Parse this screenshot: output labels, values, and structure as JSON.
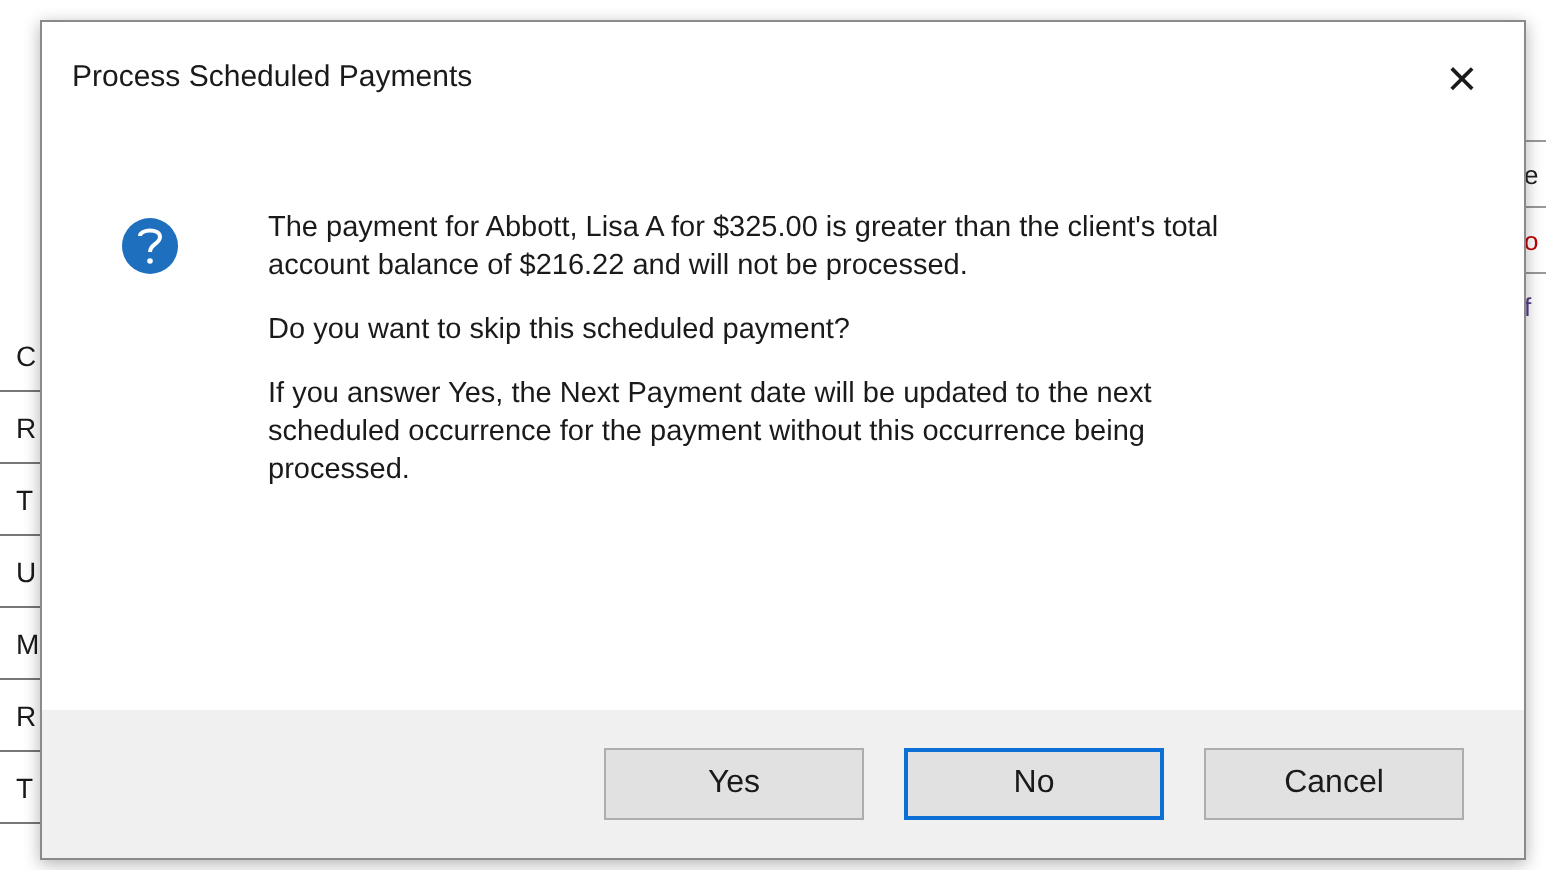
{
  "background": {
    "left_cells": [
      "C",
      "R",
      "T",
      "U",
      "M",
      "R",
      "T"
    ],
    "right_cells": [
      {
        "text": "e",
        "color": "#222222"
      },
      {
        "text": "o",
        "color": "#c00000"
      },
      {
        "text": "f",
        "color": "#5a3d8a"
      }
    ]
  },
  "dialog": {
    "title": "Process Scheduled Payments",
    "close": "×",
    "message": [
      "The payment for Abbott, Lisa A for $325.00 is greater than the client's total account balance of $216.22 and will not be processed.",
      "Do you want to skip this scheduled payment?",
      "If you answer Yes, the Next Payment date will be updated to the next scheduled occurrence for the payment without this occurrence being processed."
    ],
    "buttons": [
      {
        "label": "Yes",
        "selected": false
      },
      {
        "label": "No",
        "selected": true
      },
      {
        "label": "Cancel",
        "selected": false
      }
    ]
  }
}
